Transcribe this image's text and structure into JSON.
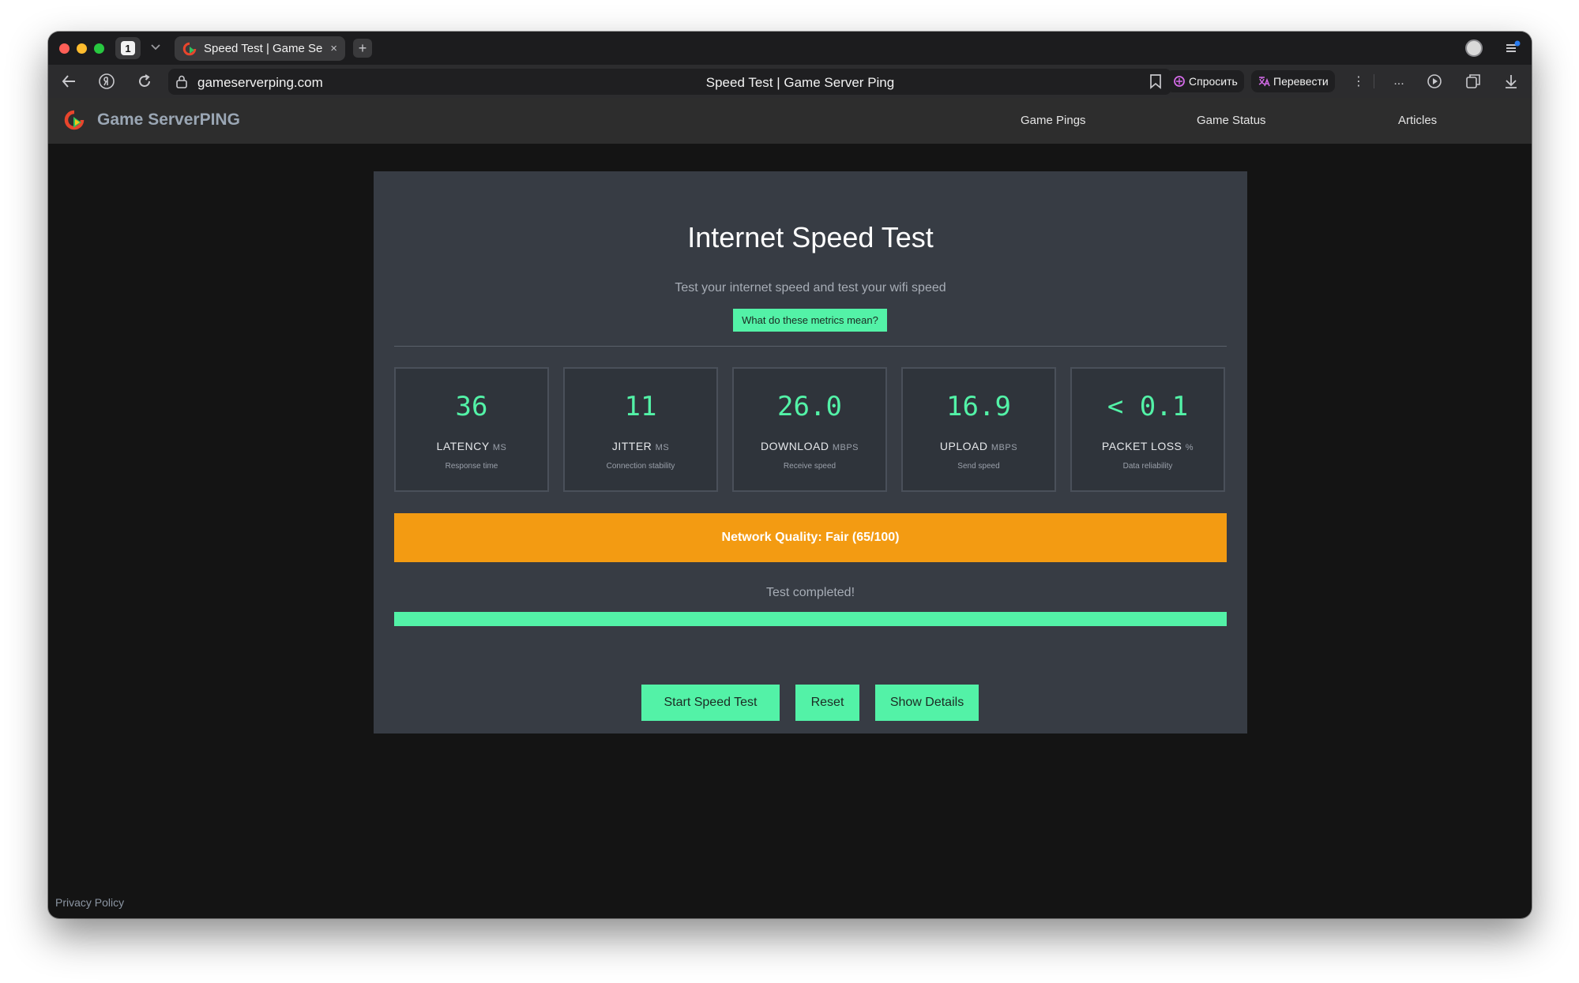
{
  "browser": {
    "tab_count": "1",
    "tab_title": "Speed Test | Game Serv",
    "tab_close": "×",
    "new_tab": "+",
    "url": "gameserverping.com",
    "page_title": "Speed Test | Game Server Ping",
    "ask_label": "Спросить",
    "translate_label": "Перевести",
    "more_label": "⋮",
    "ellipsis_label": "..."
  },
  "site": {
    "brand": "Game ServerPING",
    "nav": [
      {
        "label": "Game Pings"
      },
      {
        "label": "Game Status"
      },
      {
        "label": "Articles"
      }
    ]
  },
  "speedtest": {
    "title": "Internet Speed Test",
    "subtitle": "Test your internet speed and test your wifi speed",
    "metrics_button": "What do these metrics mean?",
    "metrics": [
      {
        "value": "36",
        "label": "LATENCY",
        "unit": "MS",
        "desc": "Response time"
      },
      {
        "value": "11",
        "label": "JITTER",
        "unit": "MS",
        "desc": "Connection stability"
      },
      {
        "value": "26.0",
        "label": "DOWNLOAD",
        "unit": "MBPS",
        "desc": "Receive speed"
      },
      {
        "value": "16.9",
        "label": "UPLOAD",
        "unit": "MBPS",
        "desc": "Send speed"
      },
      {
        "value": "< 0.1",
        "label": "PACKET LOSS",
        "unit": "%",
        "desc": "Data reliability"
      }
    ],
    "quality": "Network Quality: Fair (65/100)",
    "status": "Test completed!",
    "progress": 1.0,
    "buttons": {
      "start": "Start Speed Test",
      "reset": "Reset",
      "details": "Show Details"
    }
  },
  "footer": {
    "privacy": "Privacy Policy"
  },
  "colors": {
    "accent": "#53f2a7",
    "quality_fair": "#f39b12",
    "card_bg": "#373c44",
    "page_bg": "#141414"
  }
}
